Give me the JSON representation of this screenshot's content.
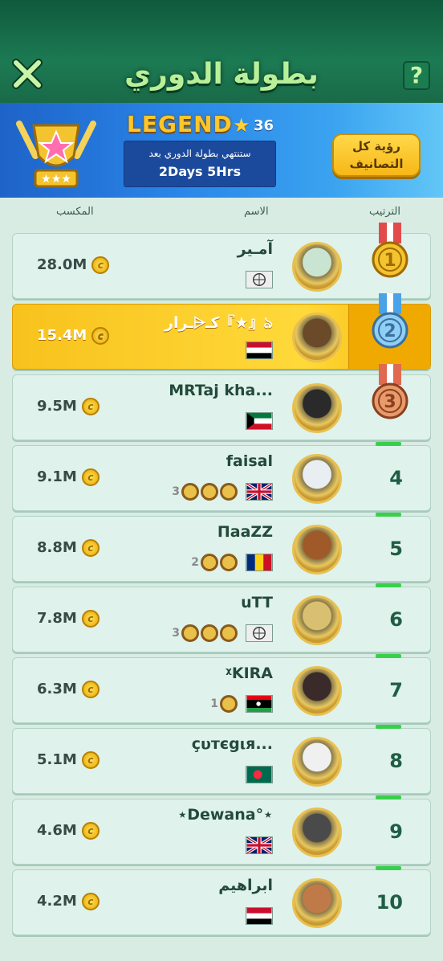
{
  "header": {
    "title": "بطولة الدوري",
    "help_label": "?"
  },
  "banner": {
    "tier": "LEGEND",
    "rank": "36",
    "ends_label": "ستنتهي بطولة الدوري بعد",
    "ends_value": "2Days 5Hrs",
    "view_button": "رؤية كل التصانيف"
  },
  "columns": {
    "earnings": "المكسب",
    "name": "الاسم",
    "rank": "الترتيب"
  },
  "rows": [
    {
      "rank": "1",
      "name": "آمـير",
      "coins": "28.0M",
      "flag": "globe"
    },
    {
      "rank": "2",
      "name": "كـ⩤ـرار『★』ঌ",
      "coins": "15.4M",
      "flag": "iraq"
    },
    {
      "rank": "3",
      "name": "MRTaj kha...",
      "coins": "9.5M",
      "flag": "kuwait"
    },
    {
      "rank": "4",
      "name": "faisal",
      "coins": "9.1M",
      "flag": "uk",
      "badge_count": "3"
    },
    {
      "rank": "5",
      "name": "ΠaaZZ",
      "coins": "8.8M",
      "flag": "romania",
      "badge_count": "2"
    },
    {
      "rank": "6",
      "name": "uTT",
      "coins": "7.8M",
      "flag": "globe",
      "badge_count": "3"
    },
    {
      "rank": "7",
      "name": "ᵡKIRA",
      "coins": "6.3M",
      "flag": "libya",
      "badge_count": "1"
    },
    {
      "rank": "8",
      "name": "çυтєgιя...",
      "coins": "5.1M",
      "flag": "bangladesh"
    },
    {
      "rank": "9",
      "name": "⋆Dewana°⋆",
      "coins": "4.6M",
      "flag": "uk"
    },
    {
      "rank": "10",
      "name": "ابراهيم",
      "coins": "4.2M",
      "flag": "iraq"
    }
  ],
  "colors": {
    "header": "#1c7a53",
    "banner": "#2a85e8",
    "row": "#dff2ec",
    "self_row": "#ffd93a",
    "rank_text": "#1f5e45"
  }
}
